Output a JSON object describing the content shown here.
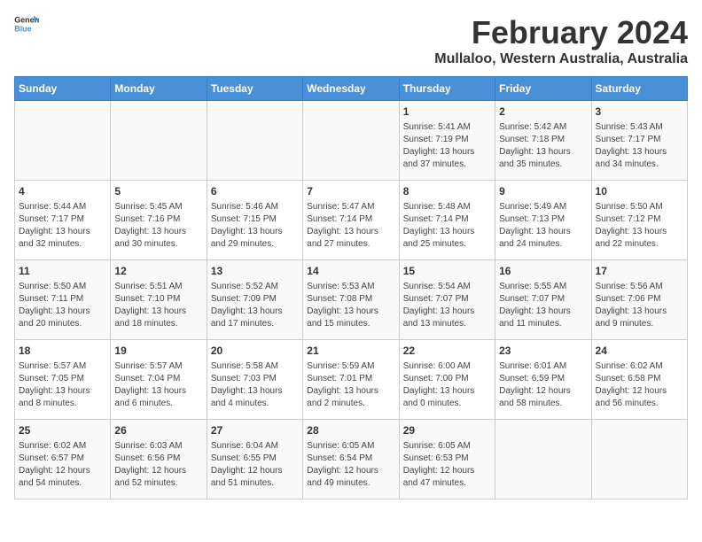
{
  "header": {
    "logo_general": "General",
    "logo_blue": "Blue",
    "title": "February 2024",
    "subtitle": "Mullaloo, Western Australia, Australia"
  },
  "days_of_week": [
    "Sunday",
    "Monday",
    "Tuesday",
    "Wednesday",
    "Thursday",
    "Friday",
    "Saturday"
  ],
  "weeks": [
    [
      {
        "day": "",
        "content": ""
      },
      {
        "day": "",
        "content": ""
      },
      {
        "day": "",
        "content": ""
      },
      {
        "day": "",
        "content": ""
      },
      {
        "day": "1",
        "content": "Sunrise: 5:41 AM\nSunset: 7:19 PM\nDaylight: 13 hours\nand 37 minutes."
      },
      {
        "day": "2",
        "content": "Sunrise: 5:42 AM\nSunset: 7:18 PM\nDaylight: 13 hours\nand 35 minutes."
      },
      {
        "day": "3",
        "content": "Sunrise: 5:43 AM\nSunset: 7:17 PM\nDaylight: 13 hours\nand 34 minutes."
      }
    ],
    [
      {
        "day": "4",
        "content": "Sunrise: 5:44 AM\nSunset: 7:17 PM\nDaylight: 13 hours\nand 32 minutes."
      },
      {
        "day": "5",
        "content": "Sunrise: 5:45 AM\nSunset: 7:16 PM\nDaylight: 13 hours\nand 30 minutes."
      },
      {
        "day": "6",
        "content": "Sunrise: 5:46 AM\nSunset: 7:15 PM\nDaylight: 13 hours\nand 29 minutes."
      },
      {
        "day": "7",
        "content": "Sunrise: 5:47 AM\nSunset: 7:14 PM\nDaylight: 13 hours\nand 27 minutes."
      },
      {
        "day": "8",
        "content": "Sunrise: 5:48 AM\nSunset: 7:14 PM\nDaylight: 13 hours\nand 25 minutes."
      },
      {
        "day": "9",
        "content": "Sunrise: 5:49 AM\nSunset: 7:13 PM\nDaylight: 13 hours\nand 24 minutes."
      },
      {
        "day": "10",
        "content": "Sunrise: 5:50 AM\nSunset: 7:12 PM\nDaylight: 13 hours\nand 22 minutes."
      }
    ],
    [
      {
        "day": "11",
        "content": "Sunrise: 5:50 AM\nSunset: 7:11 PM\nDaylight: 13 hours\nand 20 minutes."
      },
      {
        "day": "12",
        "content": "Sunrise: 5:51 AM\nSunset: 7:10 PM\nDaylight: 13 hours\nand 18 minutes."
      },
      {
        "day": "13",
        "content": "Sunrise: 5:52 AM\nSunset: 7:09 PM\nDaylight: 13 hours\nand 17 minutes."
      },
      {
        "day": "14",
        "content": "Sunrise: 5:53 AM\nSunset: 7:08 PM\nDaylight: 13 hours\nand 15 minutes."
      },
      {
        "day": "15",
        "content": "Sunrise: 5:54 AM\nSunset: 7:07 PM\nDaylight: 13 hours\nand 13 minutes."
      },
      {
        "day": "16",
        "content": "Sunrise: 5:55 AM\nSunset: 7:07 PM\nDaylight: 13 hours\nand 11 minutes."
      },
      {
        "day": "17",
        "content": "Sunrise: 5:56 AM\nSunset: 7:06 PM\nDaylight: 13 hours\nand 9 minutes."
      }
    ],
    [
      {
        "day": "18",
        "content": "Sunrise: 5:57 AM\nSunset: 7:05 PM\nDaylight: 13 hours\nand 8 minutes."
      },
      {
        "day": "19",
        "content": "Sunrise: 5:57 AM\nSunset: 7:04 PM\nDaylight: 13 hours\nand 6 minutes."
      },
      {
        "day": "20",
        "content": "Sunrise: 5:58 AM\nSunset: 7:03 PM\nDaylight: 13 hours\nand 4 minutes."
      },
      {
        "day": "21",
        "content": "Sunrise: 5:59 AM\nSunset: 7:01 PM\nDaylight: 13 hours\nand 2 minutes."
      },
      {
        "day": "22",
        "content": "Sunrise: 6:00 AM\nSunset: 7:00 PM\nDaylight: 13 hours\nand 0 minutes."
      },
      {
        "day": "23",
        "content": "Sunrise: 6:01 AM\nSunset: 6:59 PM\nDaylight: 12 hours\nand 58 minutes."
      },
      {
        "day": "24",
        "content": "Sunrise: 6:02 AM\nSunset: 6:58 PM\nDaylight: 12 hours\nand 56 minutes."
      }
    ],
    [
      {
        "day": "25",
        "content": "Sunrise: 6:02 AM\nSunset: 6:57 PM\nDaylight: 12 hours\nand 54 minutes."
      },
      {
        "day": "26",
        "content": "Sunrise: 6:03 AM\nSunset: 6:56 PM\nDaylight: 12 hours\nand 52 minutes."
      },
      {
        "day": "27",
        "content": "Sunrise: 6:04 AM\nSunset: 6:55 PM\nDaylight: 12 hours\nand 51 minutes."
      },
      {
        "day": "28",
        "content": "Sunrise: 6:05 AM\nSunset: 6:54 PM\nDaylight: 12 hours\nand 49 minutes."
      },
      {
        "day": "29",
        "content": "Sunrise: 6:05 AM\nSunset: 6:53 PM\nDaylight: 12 hours\nand 47 minutes."
      },
      {
        "day": "",
        "content": ""
      },
      {
        "day": "",
        "content": ""
      }
    ]
  ]
}
